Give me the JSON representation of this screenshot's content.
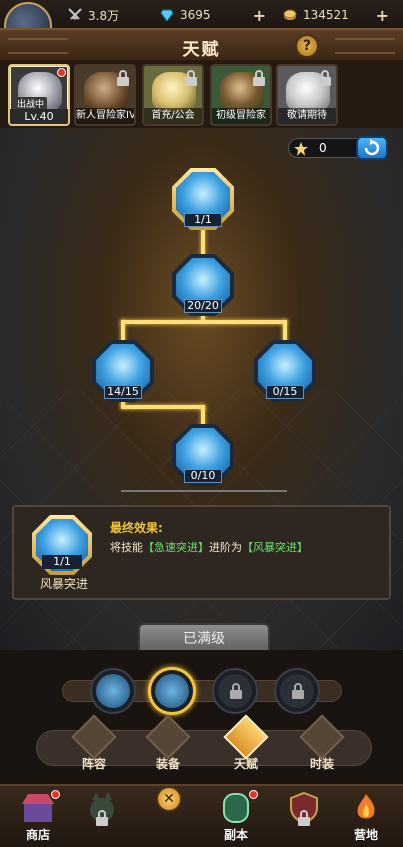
{
  "topbar": {
    "power": "3.8万",
    "gems": "3695",
    "coins": "134521",
    "plus": "+"
  },
  "title": "天赋",
  "help": "?",
  "heroes": [
    {
      "name": "出战中",
      "level": "Lv.40"
    },
    {
      "name": "新人冒险家IV"
    },
    {
      "name": "首充/公会"
    },
    {
      "name": "初级冒险家"
    },
    {
      "name": "敬请期待"
    }
  ],
  "skill_points": "0",
  "nodes": [
    {
      "level": "1/1"
    },
    {
      "level": "20/20"
    },
    {
      "level": "14/15"
    },
    {
      "level": "0/15"
    },
    {
      "level": "0/10"
    }
  ],
  "info": {
    "level": "1/1",
    "name": "风暴突进",
    "title": "最终效果:",
    "desc_prefix": "将技能",
    "skill_from": "【急速突进】",
    "desc_mid": "进阶为",
    "skill_to": "【风暴突进】"
  },
  "maxed_label": "已满级",
  "subtabs": [
    "阵容",
    "装备",
    "天赋",
    "时装"
  ],
  "nav": {
    "shop": "商店",
    "close": "✕",
    "dungeon": "副本",
    "camp": "营地"
  },
  "colors": {
    "accent_gold": "#f2c23a",
    "highlight_green": "#6ee06a",
    "tree_line": "#fbe07a"
  }
}
